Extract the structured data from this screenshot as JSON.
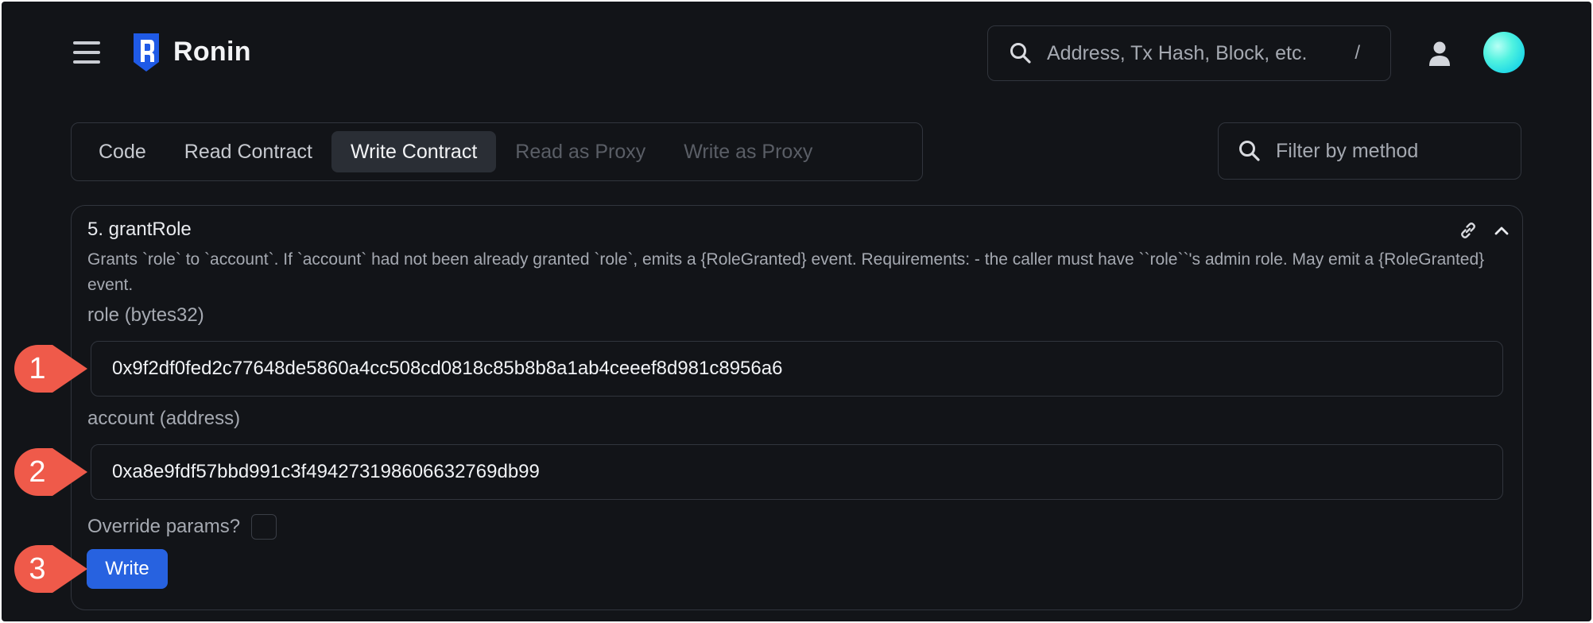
{
  "header": {
    "brand": "Ronin",
    "search_placeholder": "Address, Tx Hash, Block, etc.",
    "search_shortcut": "/"
  },
  "tabs": [
    {
      "label": "Code",
      "state": "normal"
    },
    {
      "label": "Read Contract",
      "state": "normal"
    },
    {
      "label": "Write Contract",
      "state": "active"
    },
    {
      "label": "Read as Proxy",
      "state": "disabled"
    },
    {
      "label": "Write as Proxy",
      "state": "disabled"
    }
  ],
  "filter": {
    "placeholder": "Filter by method"
  },
  "method": {
    "title": "5. grantRole",
    "description": "Grants `role` to `account`. If `account` had not been already granted `role`, emits a {RoleGranted} event. Requirements: - the caller must have ``role``'s admin role. May emit a {RoleGranted} event.",
    "role_label": "role (bytes32)",
    "role_value": "0x9f2df0fed2c77648de5860a4cc508cd0818c85b8b8a1ab4ceeef8d981c8956a6",
    "account_label": "account (address)",
    "account_value": "0xa8e9fdf57bbd991c3f494273198606632769db99",
    "override_label": "Override params?",
    "override_checked": false,
    "write_label": "Write"
  },
  "callouts": [
    "1",
    "2",
    "3"
  ],
  "colors": {
    "background": "#121418",
    "border": "#31353d",
    "active_tab": "#2a2e35",
    "primary_button": "#2762e0",
    "callout": "#ef5a4a",
    "logo": "#1f5ae6"
  }
}
